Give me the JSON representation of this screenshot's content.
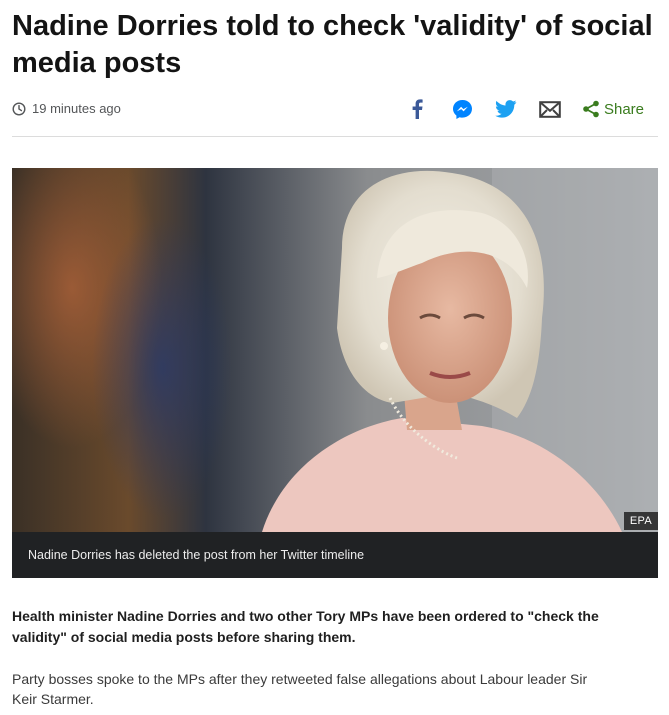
{
  "article": {
    "headline": "Nadine Dorries told to check 'validity' of social media posts",
    "timestamp": "19 minutes ago",
    "share_label": "Share",
    "image_credit": "EPA",
    "image_caption": "Nadine Dorries has deleted the post from her Twitter timeline",
    "intro": "Health minister Nadine Dorries and two other Tory MPs have been ordered to \"check the validity\" of social media posts before sharing them.",
    "paragraph_1": "Party bosses spoke to the MPs after they retweeted false allegations about Labour leader Sir Keir Starmer."
  },
  "share_icons": [
    "clock-icon",
    "facebook-icon",
    "messenger-icon",
    "twitter-icon",
    "email-icon",
    "share-icon"
  ],
  "colors": {
    "facebook": "#3b5998",
    "messenger": "#0084ff",
    "twitter": "#1da1f2",
    "email": "#404040",
    "share": "#3a7c1e",
    "caption_bar": "#202224"
  }
}
